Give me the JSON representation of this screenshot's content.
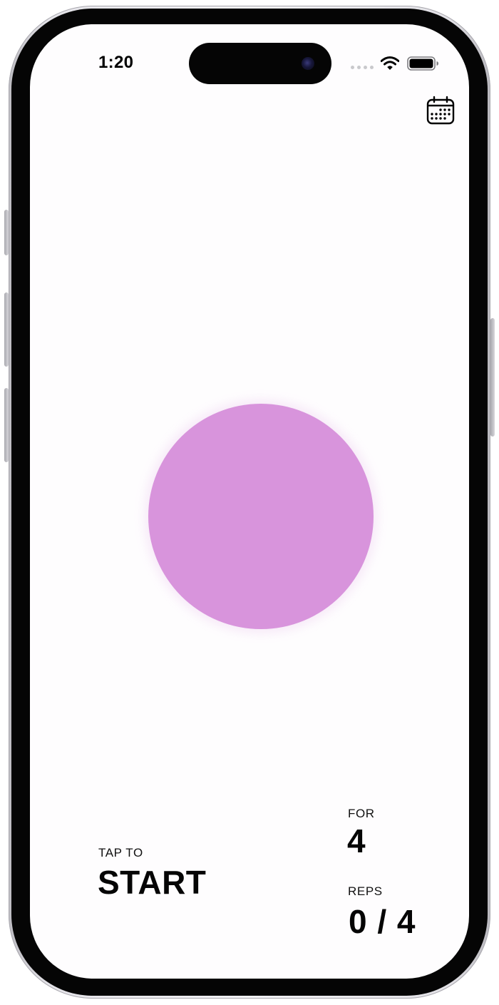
{
  "status_bar": {
    "time": "1:20"
  },
  "toolbar": {
    "calendar_icon": "calendar-icon"
  },
  "breathing": {
    "circle_color": "#d894dc"
  },
  "action": {
    "hint": "TAP TO",
    "label": "START"
  },
  "duration": {
    "label": "FOR",
    "value": "4"
  },
  "reps": {
    "label": "REPS",
    "value": "0 / 4"
  }
}
